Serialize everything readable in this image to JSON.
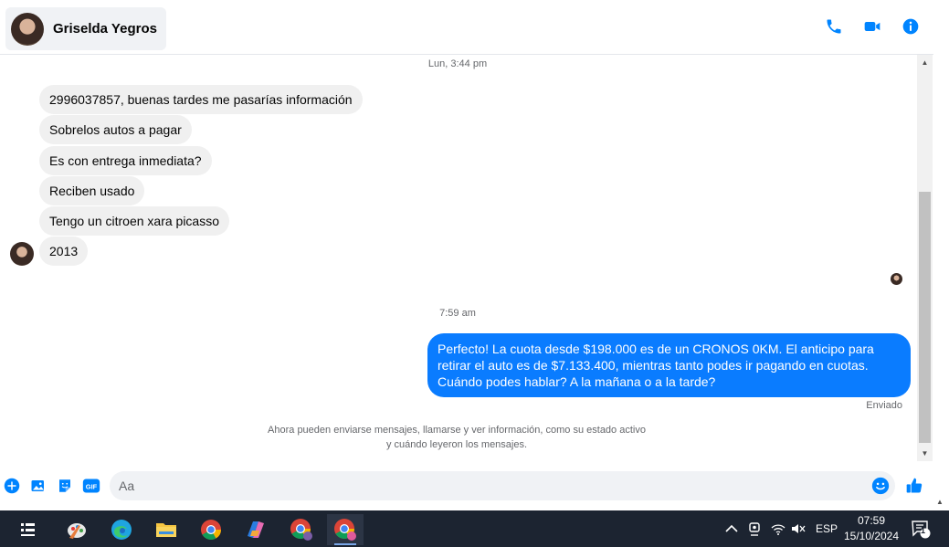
{
  "header": {
    "contact_name": "Griselda Yegros",
    "actions": [
      "phone-icon",
      "video-icon",
      "info-icon"
    ]
  },
  "conversation": {
    "timestamp_1": "Lun, 3:44 pm",
    "incoming": [
      "2996037857, buenas tardes me pasarías información",
      "Sobrelos autos a pagar",
      "Es con entrega inmediata?",
      "Reciben usado",
      "Tengo un citroen xara picasso",
      "2013"
    ],
    "timestamp_2": "7:59 am",
    "outgoing": "Perfecto! La cuota desde $198.000 es de un CRONOS 0KM. El anticipo para retirar el auto es de $7.133.400, mientras tanto podes ir pagando en cuotas. Cuándo podes hablar? A la mañana o a la tarde?",
    "sent_status": "Enviado",
    "info_note_line1": "Ahora pueden enviarse mensajes, llamarse y ver información, como su estado activo",
    "info_note_line2": "y cuándo leyeron los mensajes."
  },
  "composer": {
    "placeholder": "Aa",
    "icons": [
      "plus-icon",
      "image-icon",
      "sticker-icon",
      "gif-icon",
      "emoji-icon",
      "thumbs-up-icon"
    ]
  },
  "taskbar": {
    "apps": [
      "task-view-icon",
      "paint-icon",
      "edge-icon",
      "file-explorer-icon",
      "chrome-icon",
      "copilot-icon",
      "chrome-profile-icon",
      "chrome-active-icon"
    ],
    "language": "ESP",
    "time": "07:59",
    "date": "15/10/2024",
    "notification_count": "1"
  },
  "colors": {
    "accent": "#0a7cff",
    "messenger_blue": "#0084ff",
    "incoming_bubble": "#f0f0f0",
    "taskbar": "#1c2431"
  }
}
